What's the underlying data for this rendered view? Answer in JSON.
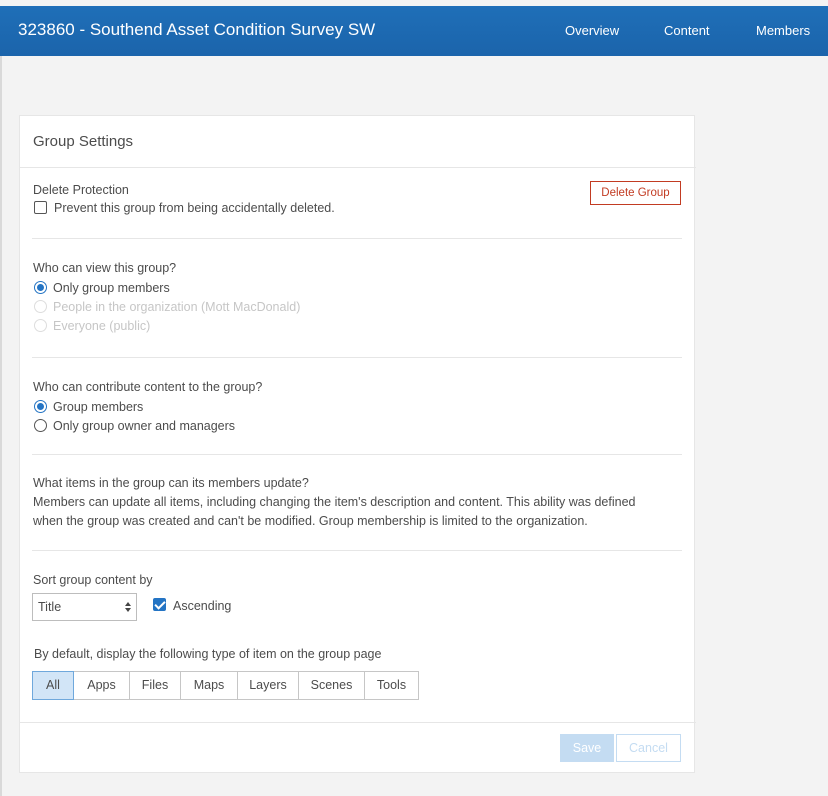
{
  "header": {
    "title": "323860 - Southend Asset Condition Survey SW",
    "nav": [
      "Overview",
      "Content",
      "Members"
    ]
  },
  "settings": {
    "title": "Group Settings",
    "delete_protection": {
      "label": "Delete Protection",
      "checkbox_label": "Prevent this group from being accidentally deleted.",
      "checked": false,
      "delete_button": "Delete Group"
    },
    "view": {
      "question": "Who can view this group?",
      "options": [
        {
          "label": "Only group members",
          "selected": true,
          "disabled": false
        },
        {
          "label": "People in the organization (Mott MacDonald)",
          "selected": false,
          "disabled": true
        },
        {
          "label": "Everyone (public)",
          "selected": false,
          "disabled": true
        }
      ]
    },
    "contribute": {
      "question": "Who can contribute content to the group?",
      "options": [
        {
          "label": "Group members",
          "selected": true
        },
        {
          "label": "Only group owner and managers",
          "selected": false
        }
      ]
    },
    "update": {
      "question": "What items in the group can its members update?",
      "line1": "Members can update all items, including changing the item's description and content. This ability was defined",
      "line2": "when the group was created and can't be modified. Group membership is limited to the organization."
    },
    "sort": {
      "label": "Sort group content by",
      "value": "Title",
      "ascending_label": "Ascending",
      "ascending": true
    },
    "display": {
      "label": "By default, display the following type of item on the group page",
      "tabs": [
        "All",
        "Apps",
        "Files",
        "Maps",
        "Layers",
        "Scenes",
        "Tools"
      ],
      "active": "All"
    },
    "save_label": "Save",
    "cancel_label": "Cancel"
  },
  "colors": {
    "header_bg": "#1f6fb8",
    "accent": "#2474c4",
    "danger": "#c23b22"
  }
}
